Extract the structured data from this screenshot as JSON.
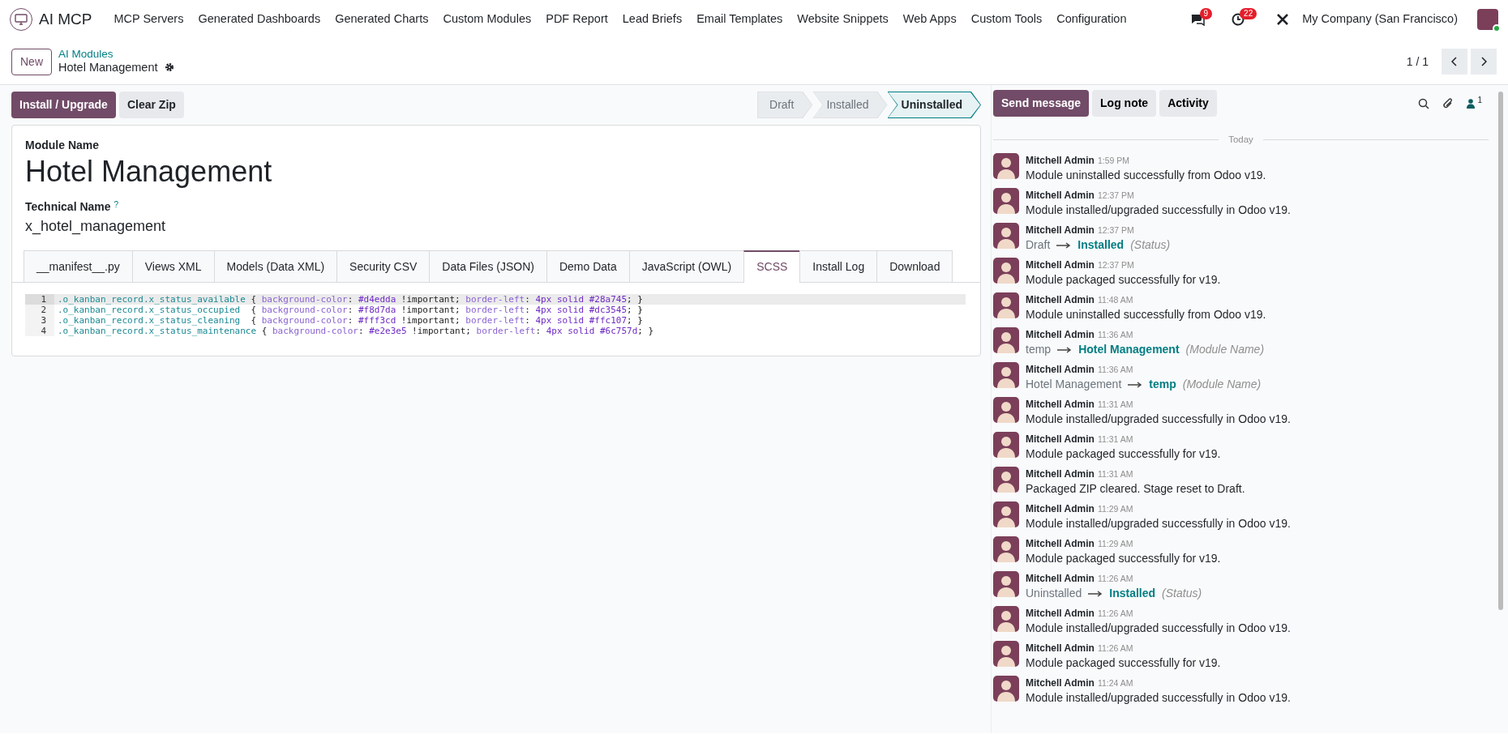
{
  "navbar": {
    "app_name": "AI MCP",
    "menu": [
      "MCP Servers",
      "Generated Dashboards",
      "Generated Charts",
      "Custom Modules",
      "PDF Report",
      "Lead Briefs",
      "Email Templates",
      "Website Snippets",
      "Web Apps",
      "Custom Tools",
      "Configuration"
    ],
    "messages_count": "9",
    "activities_count": "22",
    "company": "My Company (San Francisco)",
    "user_online": true
  },
  "control_panel": {
    "new_button": "New",
    "breadcrumb": "AI Modules",
    "record_title": "Hotel Management",
    "pager": "1 / 1"
  },
  "actions": [
    {
      "label": "Install / Upgrade",
      "primary": true
    },
    {
      "label": "Clear Zip",
      "primary": false
    }
  ],
  "stages": [
    {
      "label": "Draft",
      "selected": false
    },
    {
      "label": "Installed",
      "selected": false
    },
    {
      "label": "Uninstalled",
      "selected": true
    }
  ],
  "form": {
    "module_name_label": "Module Name",
    "module_name": "Hotel Management",
    "technical_name_label": "Technical Name",
    "help_mark": "?",
    "technical_name": "x_hotel_management"
  },
  "tabs": [
    {
      "label": "__manifest__.py",
      "selected": false
    },
    {
      "label": "Views XML",
      "selected": false
    },
    {
      "label": "Models (Data XML)",
      "selected": false
    },
    {
      "label": "Security CSV",
      "selected": false
    },
    {
      "label": "Data Files (JSON)",
      "selected": false
    },
    {
      "label": "Demo Data",
      "selected": false
    },
    {
      "label": "JavaScript (OWL)",
      "selected": false
    },
    {
      "label": "SCSS",
      "selected": true
    },
    {
      "label": "Install Log",
      "selected": false
    },
    {
      "label": "Download",
      "selected": false
    }
  ],
  "code": {
    "lines": [
      {
        "number": "1",
        "active": true,
        "tokens": [
          {
            "kind": "sel",
            "text": ".o_kanban_record.x_status_available"
          },
          {
            "kind": "txt",
            "text": " { "
          },
          {
            "kind": "prop",
            "text": "background-color"
          },
          {
            "kind": "txt",
            "text": ": "
          },
          {
            "kind": "val",
            "text": "#d4edda"
          },
          {
            "kind": "txt",
            "text": " !important; "
          },
          {
            "kind": "prop",
            "text": "border-left"
          },
          {
            "kind": "txt",
            "text": ": "
          },
          {
            "kind": "val",
            "text": "4px solid #28a745"
          },
          {
            "kind": "txt",
            "text": "; }"
          }
        ]
      },
      {
        "number": "2",
        "active": false,
        "tokens": [
          {
            "kind": "sel",
            "text": ".o_kanban_record.x_status_occupied"
          },
          {
            "kind": "txt",
            "text": "  { "
          },
          {
            "kind": "prop",
            "text": "background-color"
          },
          {
            "kind": "txt",
            "text": ": "
          },
          {
            "kind": "val",
            "text": "#f8d7da"
          },
          {
            "kind": "txt",
            "text": " !important; "
          },
          {
            "kind": "prop",
            "text": "border-left"
          },
          {
            "kind": "txt",
            "text": ": "
          },
          {
            "kind": "val",
            "text": "4px solid #dc3545"
          },
          {
            "kind": "txt",
            "text": "; }"
          }
        ]
      },
      {
        "number": "3",
        "active": false,
        "tokens": [
          {
            "kind": "sel",
            "text": ".o_kanban_record.x_status_cleaning"
          },
          {
            "kind": "txt",
            "text": "  { "
          },
          {
            "kind": "prop",
            "text": "background-color"
          },
          {
            "kind": "txt",
            "text": ": "
          },
          {
            "kind": "val",
            "text": "#fff3cd"
          },
          {
            "kind": "txt",
            "text": " !important; "
          },
          {
            "kind": "prop",
            "text": "border-left"
          },
          {
            "kind": "txt",
            "text": ": "
          },
          {
            "kind": "val",
            "text": "4px solid #ffc107"
          },
          {
            "kind": "txt",
            "text": "; }"
          }
        ]
      },
      {
        "number": "4",
        "active": false,
        "tokens": [
          {
            "kind": "sel",
            "text": ".o_kanban_record.x_status_maintenance"
          },
          {
            "kind": "txt",
            "text": " { "
          },
          {
            "kind": "prop",
            "text": "background-color"
          },
          {
            "kind": "txt",
            "text": ": "
          },
          {
            "kind": "val",
            "text": "#e2e3e5"
          },
          {
            "kind": "txt",
            "text": " !important; "
          },
          {
            "kind": "prop",
            "text": "border-left"
          },
          {
            "kind": "txt",
            "text": ": "
          },
          {
            "kind": "val",
            "text": "4px solid #6c757d"
          },
          {
            "kind": "txt",
            "text": "; }"
          }
        ]
      }
    ]
  },
  "chatter": {
    "buttons": [
      {
        "label": "Send message",
        "primary": true
      },
      {
        "label": "Log note",
        "primary": false
      },
      {
        "label": "Activity",
        "primary": false
      }
    ],
    "followers_count": "1",
    "date_separator": "Today",
    "messages": [
      {
        "author": "Mitchell Admin",
        "time": "1:59 PM",
        "kind": "text",
        "body": "Module uninstalled successfully from Odoo v19."
      },
      {
        "author": "Mitchell Admin",
        "time": "12:37 PM",
        "kind": "text",
        "body": "Module installed/upgraded successfully in Odoo v19."
      },
      {
        "author": "Mitchell Admin",
        "time": "12:37 PM",
        "kind": "change",
        "old": "Draft",
        "new": "Installed",
        "field": "(Status)"
      },
      {
        "author": "Mitchell Admin",
        "time": "12:37 PM",
        "kind": "text",
        "body": "Module packaged successfully for v19."
      },
      {
        "author": "Mitchell Admin",
        "time": "11:48 AM",
        "kind": "text",
        "body": "Module uninstalled successfully from Odoo v19."
      },
      {
        "author": "Mitchell Admin",
        "time": "11:36 AM",
        "kind": "change",
        "old": "temp",
        "new": "Hotel Management",
        "field": "(Module Name)"
      },
      {
        "author": "Mitchell Admin",
        "time": "11:36 AM",
        "kind": "change",
        "old": "Hotel Management",
        "new": "temp",
        "field": "(Module Name)"
      },
      {
        "author": "Mitchell Admin",
        "time": "11:31 AM",
        "kind": "text",
        "body": "Module installed/upgraded successfully in Odoo v19."
      },
      {
        "author": "Mitchell Admin",
        "time": "11:31 AM",
        "kind": "text",
        "body": "Module packaged successfully for v19."
      },
      {
        "author": "Mitchell Admin",
        "time": "11:31 AM",
        "kind": "text",
        "body": "Packaged ZIP cleared. Stage reset to Draft."
      },
      {
        "author": "Mitchell Admin",
        "time": "11:29 AM",
        "kind": "text",
        "body": "Module installed/upgraded successfully in Odoo v19."
      },
      {
        "author": "Mitchell Admin",
        "time": "11:29 AM",
        "kind": "text",
        "body": "Module packaged successfully for v19."
      },
      {
        "author": "Mitchell Admin",
        "time": "11:26 AM",
        "kind": "change",
        "old": "Uninstalled",
        "new": "Installed",
        "field": "(Status)"
      },
      {
        "author": "Mitchell Admin",
        "time": "11:26 AM",
        "kind": "text",
        "body": "Module installed/upgraded successfully in Odoo v19."
      },
      {
        "author": "Mitchell Admin",
        "time": "11:26 AM",
        "kind": "text",
        "body": "Module packaged successfully for v19."
      },
      {
        "author": "Mitchell Admin",
        "time": "11:24 AM",
        "kind": "text",
        "body": "Module installed/upgraded successfully in Odoo v19."
      }
    ]
  }
}
